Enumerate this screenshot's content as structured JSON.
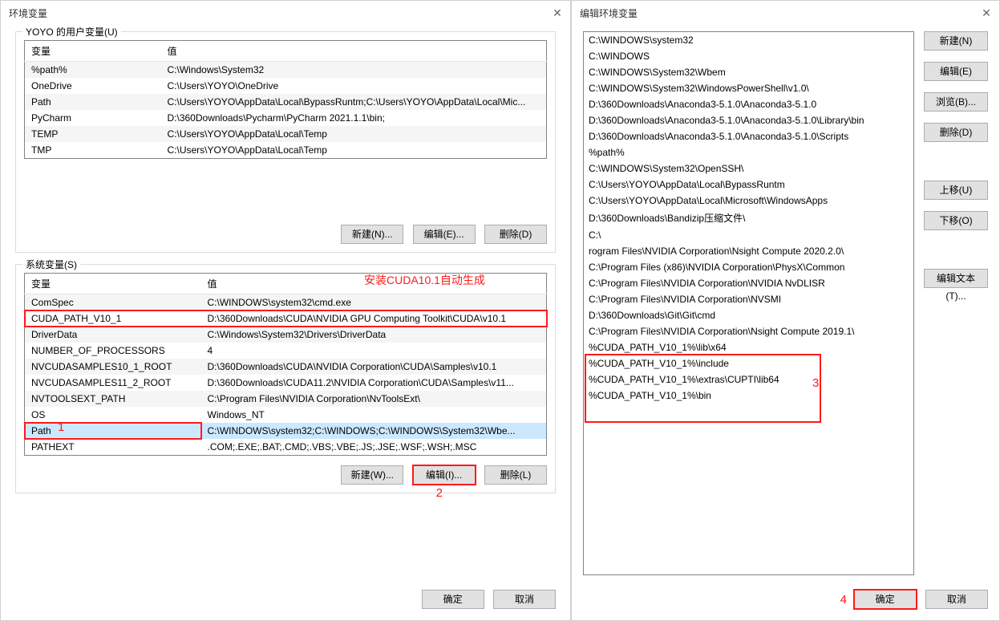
{
  "left": {
    "title": "环境变量",
    "user_group_label": "YOYO 的用户变量(U)",
    "sys_group_label": "系统变量(S)",
    "col_var": "变量",
    "col_val": "值",
    "user_vars": [
      {
        "name": "%path%",
        "value": "C:\\Windows\\System32"
      },
      {
        "name": "OneDrive",
        "value": "C:\\Users\\YOYO\\OneDrive"
      },
      {
        "name": "Path",
        "value": "C:\\Users\\YOYO\\AppData\\Local\\BypassRuntm;C:\\Users\\YOYO\\AppData\\Local\\Mic..."
      },
      {
        "name": "PyCharm",
        "value": "D:\\360Downloads\\Pycharm\\PyCharm 2021.1.1\\bin;"
      },
      {
        "name": "TEMP",
        "value": "C:\\Users\\YOYO\\AppData\\Local\\Temp"
      },
      {
        "name": "TMP",
        "value": "C:\\Users\\YOYO\\AppData\\Local\\Temp"
      }
    ],
    "sys_vars": [
      {
        "name": "ComSpec",
        "value": "C:\\WINDOWS\\system32\\cmd.exe"
      },
      {
        "name": "CUDA_PATH_V10_1",
        "value": "D:\\360Downloads\\CUDA\\NVIDIA GPU Computing Toolkit\\CUDA\\v10.1"
      },
      {
        "name": "DriverData",
        "value": "C:\\Windows\\System32\\Drivers\\DriverData"
      },
      {
        "name": "NUMBER_OF_PROCESSORS",
        "value": "4"
      },
      {
        "name": "NVCUDASAMPLES10_1_ROOT",
        "value": "D:\\360Downloads\\CUDA\\NVIDIA Corporation\\CUDA\\Samples\\v10.1"
      },
      {
        "name": "NVCUDASAMPLES11_2_ROOT",
        "value": "D:\\360Downloads\\CUDA11.2\\NVIDIA Corporation\\CUDA\\Samples\\v11..."
      },
      {
        "name": "NVTOOLSEXT_PATH",
        "value": "C:\\Program Files\\NVIDIA Corporation\\NvToolsExt\\"
      },
      {
        "name": "OS",
        "value": "Windows_NT"
      },
      {
        "name": "Path",
        "value": "C:\\WINDOWS\\system32;C:\\WINDOWS;C:\\WINDOWS\\System32\\Wbe..."
      },
      {
        "name": "PATHEXT",
        "value": ".COM;.EXE;.BAT;.CMD;.VBS;.VBE;.JS;.JSE;.WSF;.WSH;.MSC"
      }
    ],
    "btn_new_u": "新建(N)...",
    "btn_edit_u": "编辑(E)...",
    "btn_del_u": "删除(D)",
    "btn_new_s": "新建(W)...",
    "btn_edit_s": "编辑(I)...",
    "btn_del_s": "删除(L)",
    "btn_ok": "确定",
    "btn_cancel": "取消",
    "annot_cuda": "安装CUDA10.1自动生成",
    "annot_1": "1",
    "annot_2": "2"
  },
  "right": {
    "title": "编辑环境变量",
    "paths": [
      "C:\\WINDOWS\\system32",
      "C:\\WINDOWS",
      "C:\\WINDOWS\\System32\\Wbem",
      "C:\\WINDOWS\\System32\\WindowsPowerShell\\v1.0\\",
      "D:\\360Downloads\\Anaconda3-5.1.0\\Anaconda3-5.1.0",
      "D:\\360Downloads\\Anaconda3-5.1.0\\Anaconda3-5.1.0\\Library\\bin",
      "D:\\360Downloads\\Anaconda3-5.1.0\\Anaconda3-5.1.0\\Scripts",
      "%path%",
      "C:\\WINDOWS\\System32\\OpenSSH\\",
      "C:\\Users\\YOYO\\AppData\\Local\\BypassRuntm",
      "C:\\Users\\YOYO\\AppData\\Local\\Microsoft\\WindowsApps",
      "D:\\360Downloads\\Bandizip压缩文件\\",
      "C:\\",
      "rogram Files\\NVIDIA Corporation\\Nsight Compute 2020.2.0\\",
      "C:\\Program Files (x86)\\NVIDIA Corporation\\PhysX\\Common",
      "C:\\Program Files\\NVIDIA Corporation\\NVIDIA NvDLISR",
      "C:\\Program Files\\NVIDIA Corporation\\NVSMI",
      "D:\\360Downloads\\Git\\Git\\cmd",
      "C:\\Program Files\\NVIDIA Corporation\\Nsight Compute 2019.1\\",
      "%CUDA_PATH_V10_1%\\lib\\x64",
      "%CUDA_PATH_V10_1%\\include",
      "%CUDA_PATH_V10_1%\\extras\\CUPTI\\lib64",
      "%CUDA_PATH_V10_1%\\bin"
    ],
    "btn_new": "新建(N)",
    "btn_edit": "编辑(E)",
    "btn_browse": "浏览(B)...",
    "btn_del": "删除(D)",
    "btn_up": "上移(U)",
    "btn_down": "下移(O)",
    "btn_text": "编辑文本(T)...",
    "btn_ok": "确定",
    "btn_cancel": "取消",
    "annot_3": "3",
    "annot_4": "4"
  }
}
